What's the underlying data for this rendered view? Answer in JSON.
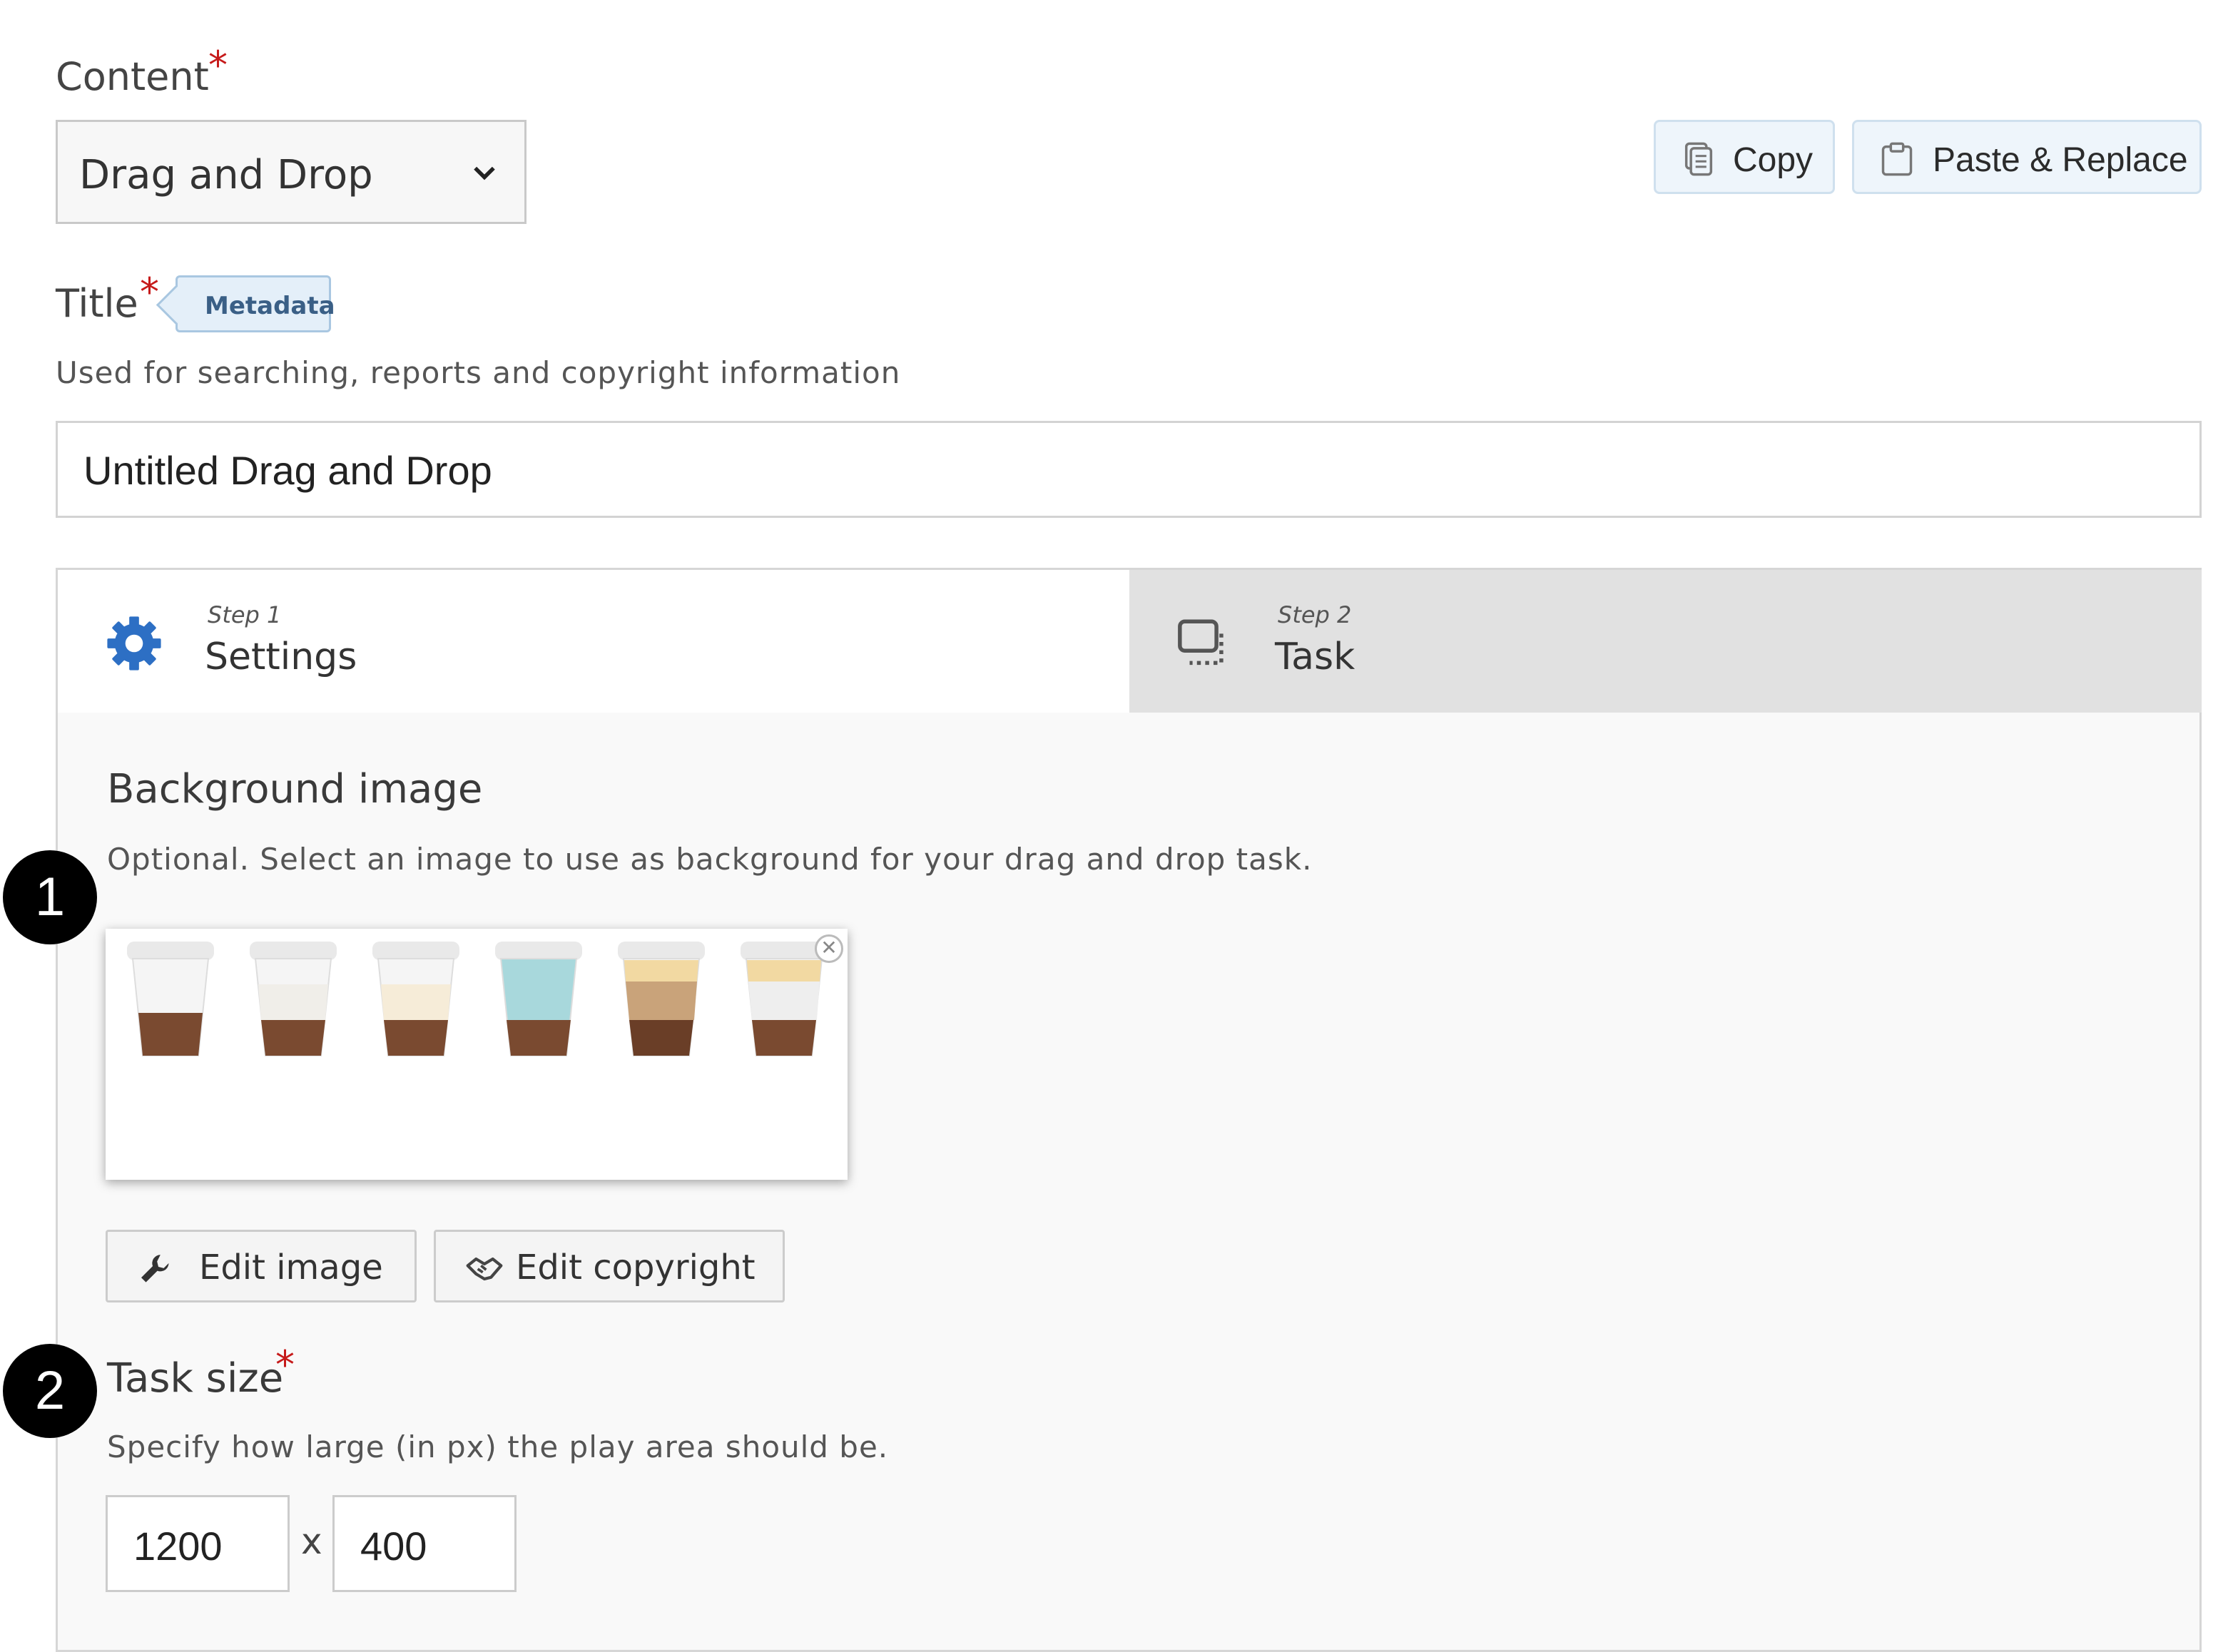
{
  "content": {
    "label": "Content",
    "required_mark": "*",
    "selected": "Drag and Drop"
  },
  "actions": {
    "copy": "Copy",
    "paste": "Paste & Replace"
  },
  "title_field": {
    "label": "Title",
    "required_mark": "*",
    "tag": "Metadata",
    "description": "Used for searching, reports and copyright information",
    "value": "Untitled Drag and Drop"
  },
  "wizard": {
    "tabs": [
      {
        "step": "Step 1",
        "name": "Settings",
        "icon": "gear-icon",
        "active": true
      },
      {
        "step": "Step 2",
        "name": "Task",
        "icon": "dashed-frame-icon",
        "active": false
      }
    ]
  },
  "background_image": {
    "heading": "Background image",
    "description": "Optional. Select an image to use as background for your drag and drop task.",
    "edit_image": "Edit image",
    "edit_copyright": "Edit copyright"
  },
  "task_size": {
    "heading": "Task size",
    "required_mark": "*",
    "description": "Specify how large (in px) the play area should be.",
    "width": "1200",
    "separator": "x",
    "height": "400"
  },
  "annotations": {
    "one": "1",
    "two": "2"
  },
  "colors": {
    "accent": "#2d6fc4",
    "required": "#c61a1a",
    "tab_inactive": "#e1e1e1"
  }
}
